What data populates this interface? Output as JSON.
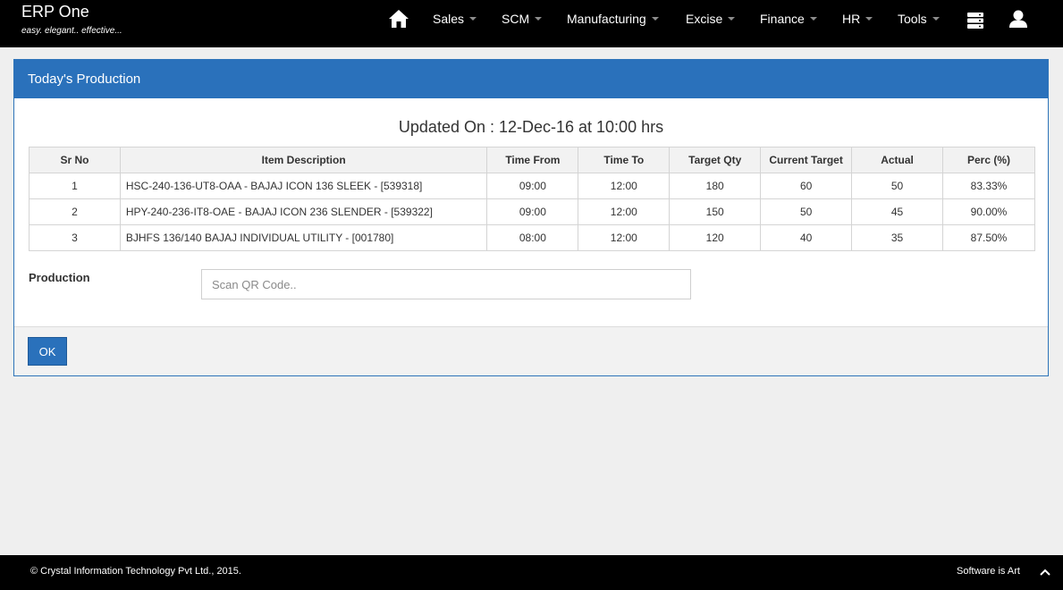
{
  "app": {
    "title": "ERP One",
    "tagline": "easy. elegant.. effective..."
  },
  "nav": {
    "home_icon": "home-icon",
    "items": [
      {
        "label": "Sales"
      },
      {
        "label": "SCM"
      },
      {
        "label": "Manufacturing"
      },
      {
        "label": "Excise"
      },
      {
        "label": "Finance"
      },
      {
        "label": "HR"
      },
      {
        "label": "Tools"
      }
    ],
    "database_icon": "database-icon",
    "user_icon": "user-icon"
  },
  "panel": {
    "title": "Today's Production",
    "updated": "Updated On : 12-Dec-16 at 10:00 hrs",
    "columns": [
      "Sr No",
      "Item Description",
      "Time From",
      "Time To",
      "Target Qty",
      "Current Target",
      "Actual",
      "Perc (%)"
    ],
    "rows": [
      [
        "1",
        "HSC-240-136-UT8-OAA - BAJAJ ICON 136 SLEEK - [539318]",
        "09:00",
        "12:00",
        "180",
        "60",
        "50",
        "83.33%"
      ],
      [
        "2",
        "HPY-240-236-IT8-OAE - BAJAJ ICON 236 SLENDER - [539322]",
        "09:00",
        "12:00",
        "150",
        "50",
        "45",
        "90.00%"
      ],
      [
        "3",
        "BJHFS 136/140 BAJAJ INDIVIDUAL UTILITY - [001780]",
        "08:00",
        "12:00",
        "120",
        "40",
        "35",
        "87.50%"
      ]
    ],
    "production_label": "Production",
    "qr_placeholder": "Scan QR Code..",
    "qr_value": "",
    "ok_label": "OK"
  },
  "footer": {
    "copyright": "© Crystal Information Technology Pvt Ltd., 2015.",
    "motto": "Software is Art",
    "scroll_icon": "chevron-up-icon"
  },
  "colors": {
    "navbar": "#000000",
    "primary": "#2a71bb",
    "page_bg": "#efefef"
  }
}
